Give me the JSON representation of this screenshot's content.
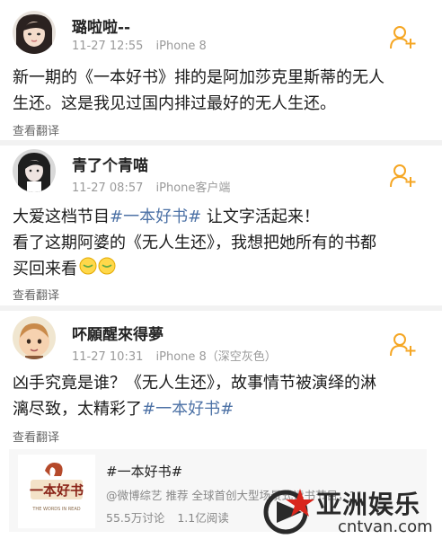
{
  "posts": [
    {
      "username": "璐啦啦--",
      "time": "11-27 12:55",
      "device": "iPhone 8",
      "lines": [
        "新一期的《一本好书》排的是阿加莎克里斯蒂的无人",
        "生还。这是我见过国内排过最好的无人生还。"
      ],
      "translate": "查看翻译"
    },
    {
      "username": "青了个青喵",
      "time": "11-27 08:57",
      "device": "iPhone客户端",
      "line1_pre": "大爱这档节目",
      "line1_tag": "#一本好书#",
      "line1_post": " 让文字活起来！",
      "line2": "看了这期阿婆的《无人生还》，我想把她所有的书都",
      "line3": "买回来看",
      "translate": "查看翻译"
    },
    {
      "username": "吥願醒來得夢",
      "time": "11-27 10:31",
      "device": "iPhone 8（深空灰色）",
      "line1": "凶手究竟是谁？《无人生还》，故事情节被演绎的淋",
      "line2_pre": "漓尽致，太精彩了",
      "line2_tag": "#一本好书#",
      "translate": "查看翻译"
    }
  ],
  "topic_card": {
    "title": "#一本好书#",
    "source": "@微博综艺",
    "recommend": "推荐",
    "desc": "全球首创大型场景式读书节目，11",
    "discussions": "55.5万讨论",
    "reads": "1.1亿阅读",
    "logo_text": "一本好书",
    "logo_sub": "THE WORDS IN READ"
  },
  "watermark": {
    "cn": "亚洲娱乐",
    "en": "cntvan.com"
  },
  "colors": {
    "tag": "#4d72a6",
    "follow_icon": "#f5a623",
    "watermark_star": "#d9261c"
  }
}
